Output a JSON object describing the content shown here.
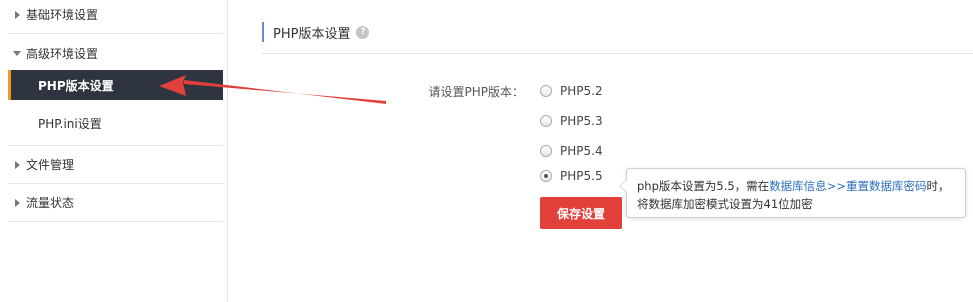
{
  "sidebar": {
    "groups": [
      {
        "label": "基础环境设置",
        "expanded": false
      },
      {
        "label": "高级环境设置",
        "expanded": true
      },
      {
        "label": "文件管理",
        "expanded": false
      },
      {
        "label": "流量状态",
        "expanded": false
      }
    ],
    "sub_items": [
      {
        "label": "PHP版本设置",
        "active": true
      },
      {
        "label": "PHP.ini设置",
        "active": false
      }
    ]
  },
  "section": {
    "title": "PHP版本设置",
    "help_icon": "?"
  },
  "form": {
    "label": "请设置PHP版本：",
    "options": [
      {
        "label": "PHP5.2",
        "checked": false
      },
      {
        "label": "PHP5.3",
        "checked": false
      },
      {
        "label": "PHP5.4",
        "checked": false
      },
      {
        "label": "PHP5.5",
        "checked": true
      }
    ],
    "save_label": "保存设置"
  },
  "tooltip": {
    "text_before": "php版本设置为5.5，需在",
    "link1": "数据库信息",
    "sep": ">>",
    "link2": "重置数据库密码",
    "text_after": "时，",
    "line2": "将数据库加密模式设置为41位加密"
  },
  "colors": {
    "active_bg": "#2e3541",
    "active_accent": "#ef9b1c",
    "save_button": "#e2403b",
    "arrow": "#e2403b",
    "link": "#2a6ebb"
  }
}
